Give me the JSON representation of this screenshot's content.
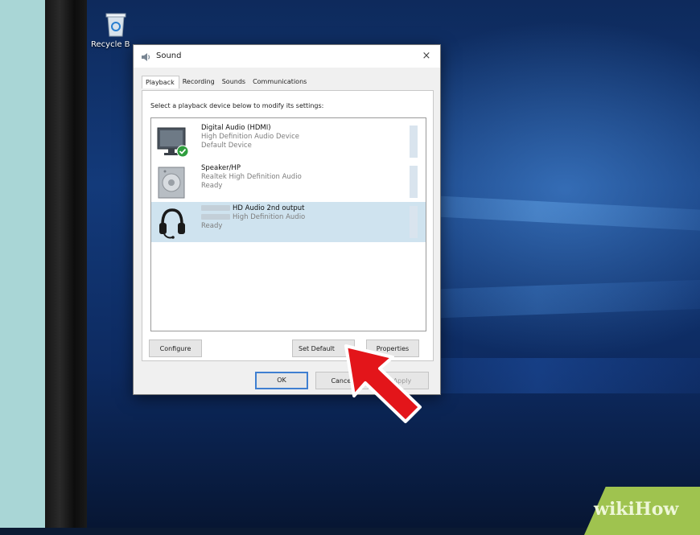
{
  "desktop": {
    "recycle_bin_label": "Recycle B"
  },
  "dialog": {
    "title": "Sound",
    "close_glyph": "×",
    "tabs": [
      {
        "label": "Playback",
        "active": true
      },
      {
        "label": "Recording",
        "active": false
      },
      {
        "label": "Sounds",
        "active": false
      },
      {
        "label": "Communications",
        "active": false
      }
    ],
    "instruction": "Select a playback device below to modify its settings:",
    "devices": [
      {
        "name": "Digital Audio (HDMI)",
        "driver": "High Definition Audio Device",
        "status": "Default Device",
        "icon": "monitor-icon",
        "default_badge": "check-icon"
      },
      {
        "name": "Speaker/HP",
        "driver": "Realtek High Definition Audio",
        "status": "Ready",
        "icon": "speaker-icon"
      },
      {
        "name": "HD Audio 2nd output",
        "driver": "High Definition Audio",
        "status": "Ready",
        "icon": "headphones-icon",
        "selected": true
      }
    ],
    "buttons": {
      "configure": "Configure",
      "set_default": "Set Default",
      "properties": "Properties",
      "ok": "OK",
      "cancel": "Cancel",
      "apply": "Apply"
    }
  },
  "watermark": {
    "part1": "wiki",
    "part2": "How"
  },
  "colors": {
    "selected_row": "#cfe3ef",
    "ok_border": "#3f7fd1",
    "arrow": "#e3151a",
    "watermark": "#9fc34f"
  }
}
